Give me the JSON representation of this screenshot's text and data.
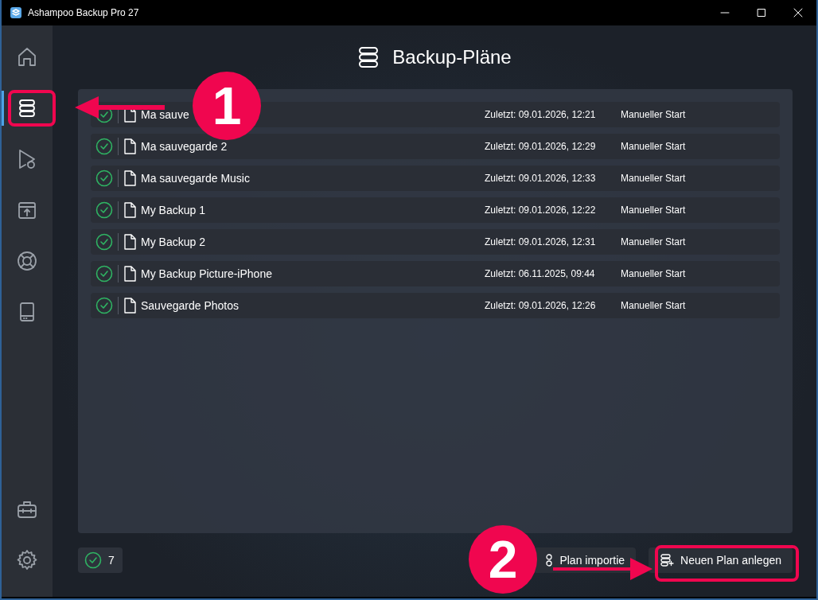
{
  "window": {
    "title": "Ashampoo Backup Pro 27"
  },
  "sidebar": {
    "items": [
      {
        "kind": "home",
        "selected": false
      },
      {
        "kind": "plans",
        "selected": true
      },
      {
        "kind": "restore",
        "selected": false
      },
      {
        "kind": "archive",
        "selected": false
      },
      {
        "kind": "help",
        "selected": false
      },
      {
        "kind": "drive",
        "selected": false
      }
    ],
    "bottom_items": [
      {
        "kind": "tools",
        "selected": false
      },
      {
        "kind": "settings",
        "selected": false
      }
    ]
  },
  "page_title": "Backup-Pläne",
  "plans": [
    {
      "name": "Ma sauve",
      "last_run": "Zuletzt: 09.01.2026, 12:21",
      "schedule": "Manueller Start",
      "ok": true
    },
    {
      "name": "Ma sauvegarde 2",
      "last_run": "Zuletzt: 09.01.2026, 12:29",
      "schedule": "Manueller Start",
      "ok": true
    },
    {
      "name": "Ma sauvegarde Music",
      "last_run": "Zuletzt: 09.01.2026, 12:33",
      "schedule": "Manueller Start",
      "ok": true
    },
    {
      "name": "My Backup 1",
      "last_run": "Zuletzt: 09.01.2026, 12:22",
      "schedule": "Manueller Start",
      "ok": true
    },
    {
      "name": "My Backup 2",
      "last_run": "Zuletzt: 09.01.2026, 12:31",
      "schedule": "Manueller Start",
      "ok": true
    },
    {
      "name": "My Backup Picture-iPhone",
      "last_run": "Zuletzt: 06.11.2025, 09:44",
      "schedule": "Manueller Start",
      "ok": true
    },
    {
      "name": "Sauvegarde Photos",
      "last_run": "Zuletzt: 09.01.2026, 12:26",
      "schedule": "Manueller Start",
      "ok": true
    }
  ],
  "footer": {
    "ok_count": "7",
    "buttons": [
      {
        "kind": "import",
        "label": "Plan importie"
      },
      {
        "kind": "new",
        "label": "Neuen Plan anlegen"
      }
    ]
  },
  "annotations": [
    {
      "number": "1"
    },
    {
      "number": "2"
    }
  ]
}
